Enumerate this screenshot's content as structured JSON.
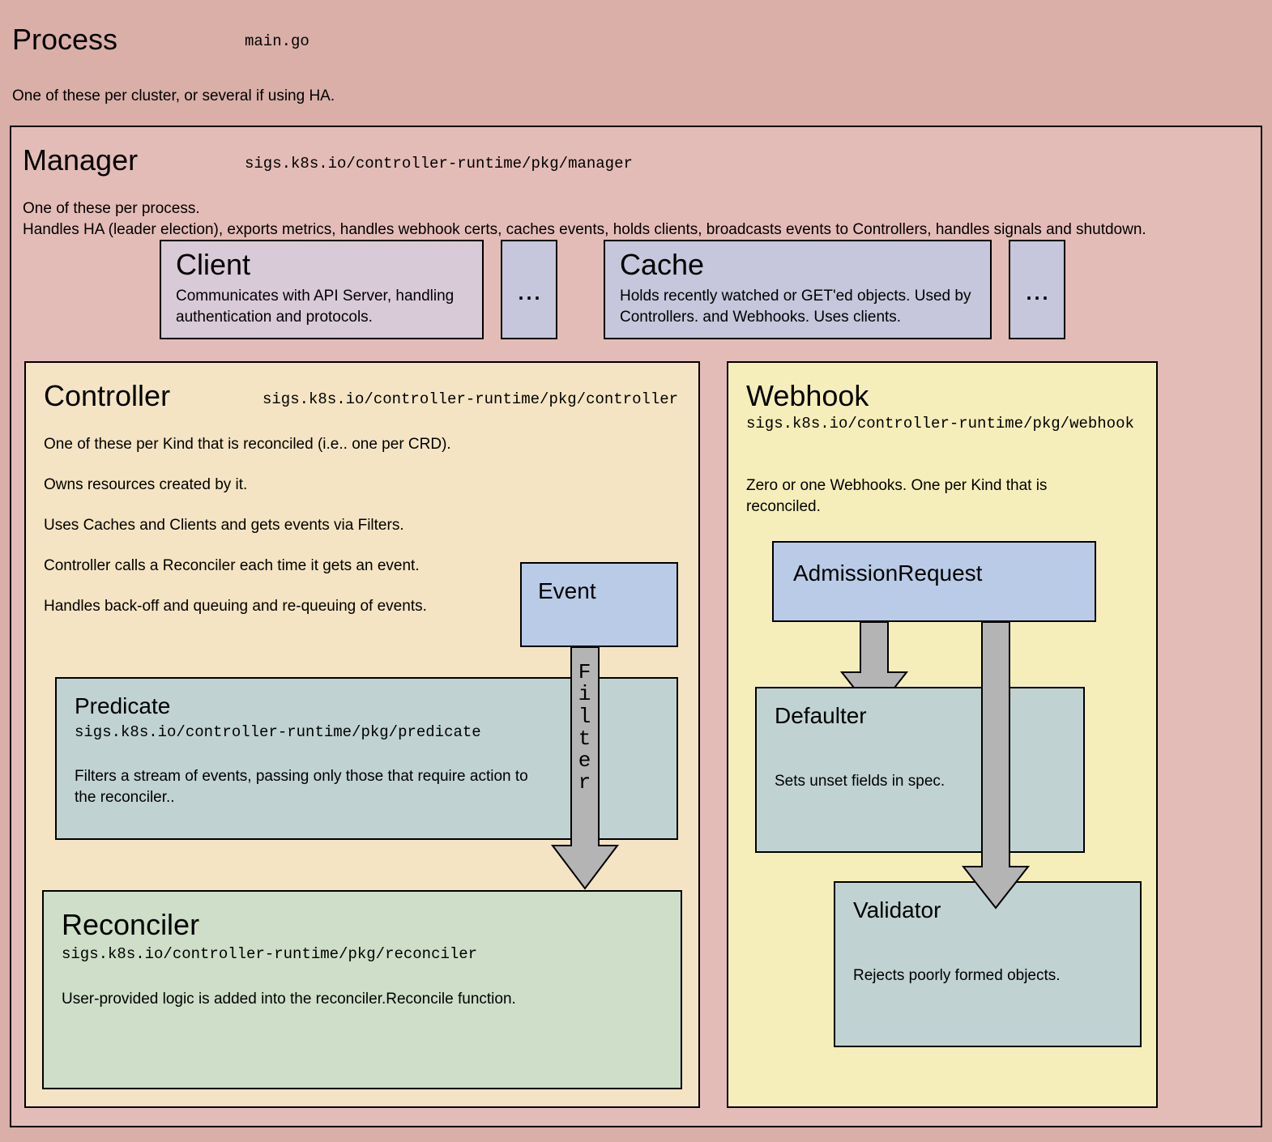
{
  "process": {
    "title": "Process",
    "pkg": "main.go",
    "desc": "One of these per cluster, or several if using HA."
  },
  "manager": {
    "title": "Manager",
    "pkg": "sigs.k8s.io/controller-runtime/pkg/manager",
    "desc_line1": "One of these per process.",
    "desc_line2": "Handles HA (leader election), exports metrics, handles webhook certs, caches events, holds clients, broadcasts events to Controllers, handles signals and shutdown."
  },
  "client": {
    "title": "Client",
    "desc": "Communicates with API Server, handling authentication and protocols."
  },
  "ellipsis1": "...",
  "cache": {
    "title": "Cache",
    "desc": "Holds recently watched or GET'ed objects.   Used by Controllers. and Webhooks.  Uses clients."
  },
  "ellipsis2": "...",
  "controller": {
    "title": "Controller",
    "pkg": "sigs.k8s.io/controller-runtime/pkg/controller",
    "desc1": "One of these per Kind that is reconciled (i.e.. one per CRD).",
    "desc2": "Owns resources created by it.",
    "desc3": "Uses Caches and Clients and gets events via Filters.",
    "desc4": "Controller calls a Reconciler each time it gets an event.",
    "desc5": "Handles back-off and queuing and re-queuing of events."
  },
  "event": {
    "title": "Event"
  },
  "filter_label": "Filter",
  "predicate": {
    "title": "Predicate",
    "pkg": "sigs.k8s.io/controller-runtime/pkg/predicate",
    "desc": "Filters a stream of events, passing only those that require  action to the reconciler.."
  },
  "reconciler": {
    "title": "Reconciler",
    "pkg": "sigs.k8s.io/controller-runtime/pkg/reconciler",
    "desc": "User-provided logic is added into the reconciler.Reconcile function."
  },
  "webhook": {
    "title": "Webhook",
    "pkg": "sigs.k8s.io/controller-runtime/pkg/webhook",
    "desc": "Zero or one Webhooks.  One per Kind that is reconciled."
  },
  "admission": {
    "title": "AdmissionRequest"
  },
  "defaulter": {
    "title": "Defaulter",
    "desc": "Sets unset fields in spec."
  },
  "validator": {
    "title": "Validator",
    "desc": "Rejects poorly formed objects."
  }
}
